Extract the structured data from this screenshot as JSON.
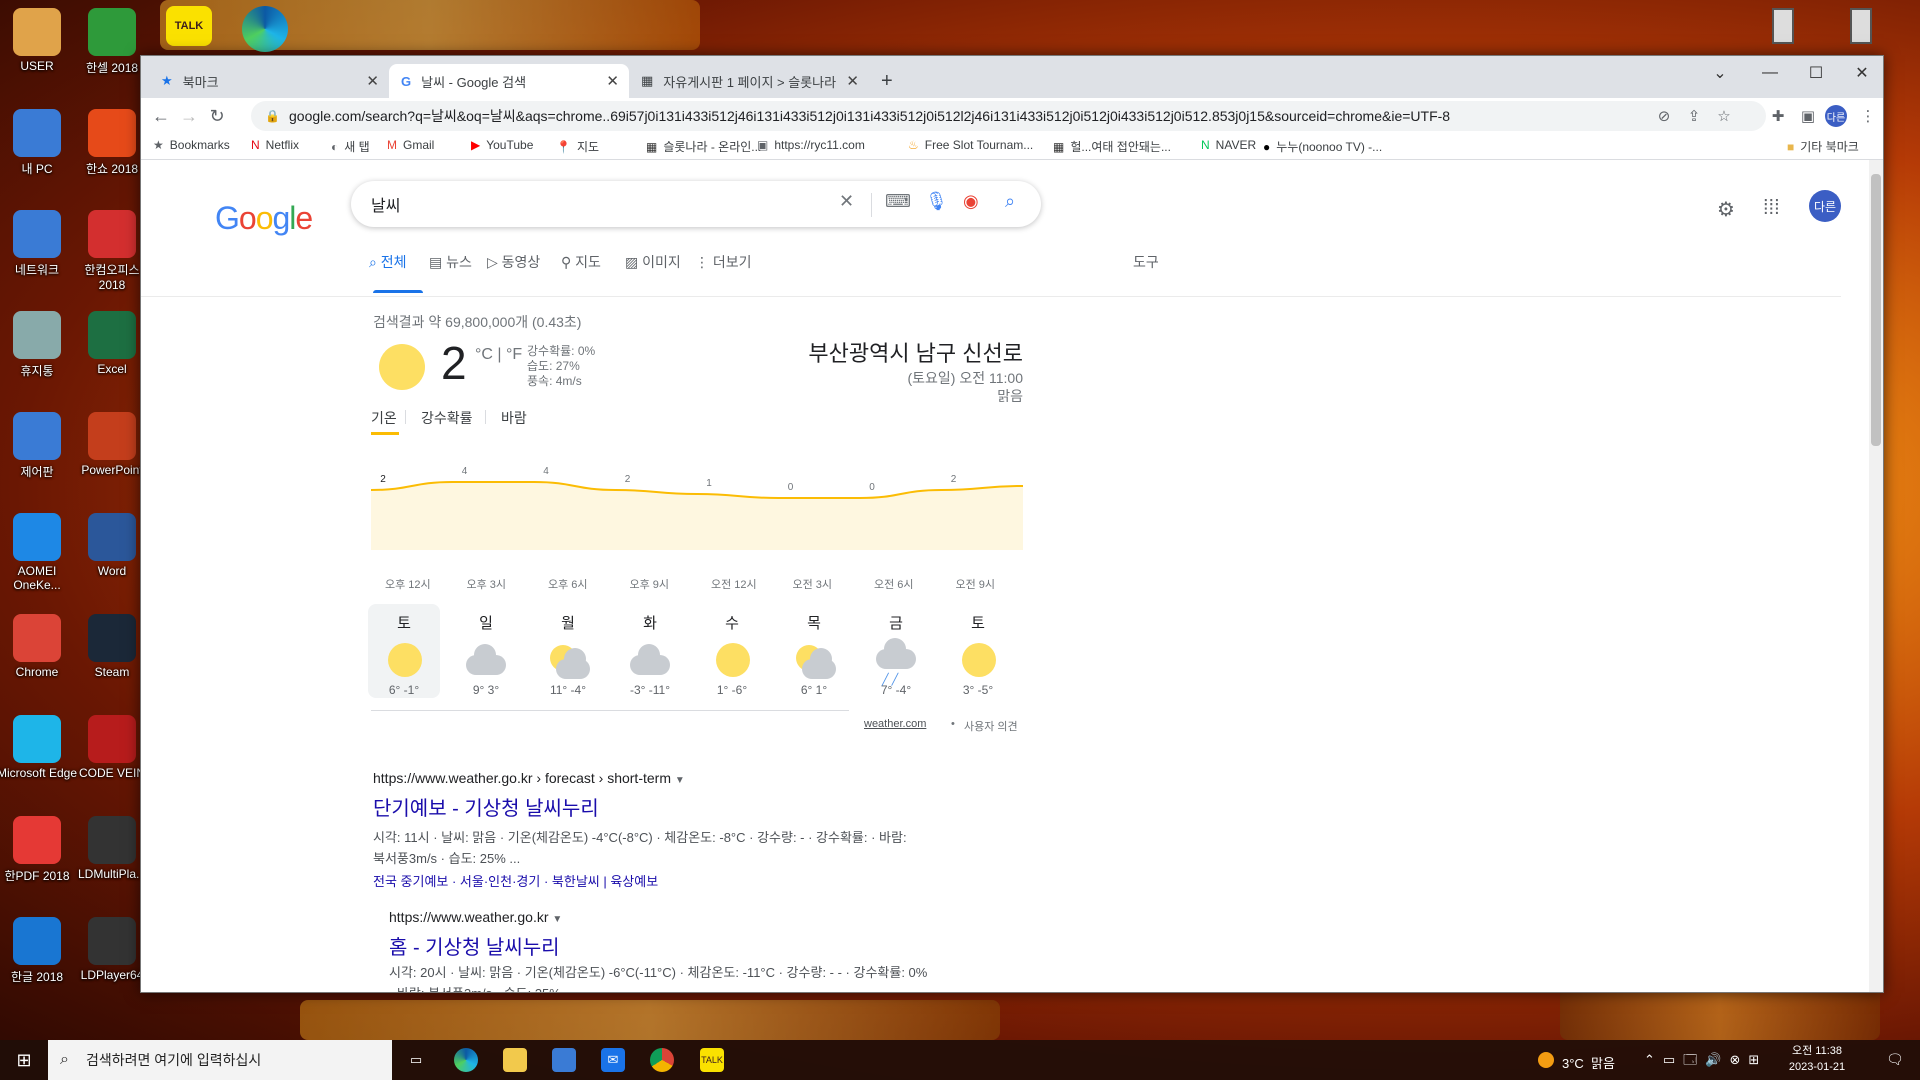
{
  "desktop": {
    "col1": [
      "USER",
      "내 PC",
      "네트워크",
      "휴지통",
      "제어판",
      "AOMEI OneKe...",
      "Chrome",
      "Microsoft Edge",
      "한PDF 2018",
      "한글 2018"
    ],
    "col2": [
      "한셀 2018",
      "한쇼 2018",
      "한컴오피스 2018",
      "Excel",
      "PowerPoint",
      "Word",
      "Steam",
      "CODE VEIN",
      "LDMultiPla...",
      "LDPlayer64"
    ],
    "topicons": [
      "TALK",
      ""
    ]
  },
  "browser": {
    "tabs": [
      {
        "label": "북마크",
        "icon": "star-icon"
      },
      {
        "label": "날씨 - Google 검색",
        "icon": "google-icon"
      },
      {
        "label": "자유게시판 1 페이지 > 슬롯나라",
        "icon": "film-icon"
      }
    ],
    "new_tab": "+",
    "url": "google.com/search?q=날씨&oq=날씨&aqs=chrome..69i57j0i131i433i512j46i131i433i512j0i131i433i512j0i512l2j46i131i433i512j0i512j0i433i512j0i512.853j0j15&sourceid=chrome&ie=UTF-8",
    "profile": "다른",
    "bookmarks": [
      "Bookmarks",
      "Netflix",
      "새 탭",
      "Gmail",
      "YouTube",
      "지도",
      "슬롯나라 - 온라인...",
      "https://ryc11.com",
      "Free Slot Tournam...",
      "헐...여태 접안돼는...",
      "NAVER",
      "누누(noonoo TV) -..."
    ],
    "other_bookmarks": "기타 북마크"
  },
  "google": {
    "logo": [
      "G",
      "o",
      "o",
      "g",
      "l",
      "e"
    ],
    "query": "날씨",
    "tabs": [
      "전체",
      "뉴스",
      "동영상",
      "지도",
      "이미지",
      "더보기"
    ],
    "tools": "도구",
    "result_stats": "검색결과 약 69,800,000개 (0.43초)",
    "avatar": "다른"
  },
  "weather": {
    "temp": "2",
    "units": "°C | °F",
    "precip": "강수확률: 0%",
    "humidity": "습도: 27%",
    "wind": "풍속: 4m/s",
    "location": "부산광역시 남구 신선로",
    "time": "(토요일) 오전 11:00",
    "condition": "맑음",
    "tabs": [
      "기온",
      "강수확률",
      "바람"
    ],
    "chart_points": [
      2,
      4,
      4,
      2,
      1,
      0,
      0,
      2,
      3
    ],
    "chart_labels": [
      "2",
      "4",
      "4",
      "2",
      "1",
      "0",
      "0",
      "2"
    ],
    "hours": [
      "오후 12시",
      "오후 3시",
      "오후 6시",
      "오후 9시",
      "오전 12시",
      "오전 3시",
      "오전 6시",
      "오전 9시"
    ],
    "days": [
      {
        "name": "토",
        "icon": "sunny",
        "temps": "6° -1°"
      },
      {
        "name": "일",
        "icon": "cloudy",
        "temps": "9° 3°"
      },
      {
        "name": "월",
        "icon": "partly-cloudy",
        "temps": "11° -4°"
      },
      {
        "name": "화",
        "icon": "cloudy",
        "temps": "-3° -11°"
      },
      {
        "name": "수",
        "icon": "sunny",
        "temps": "1° -6°"
      },
      {
        "name": "목",
        "icon": "partly-cloudy",
        "temps": "6° 1°"
      },
      {
        "name": "금",
        "icon": "rain",
        "temps": "7° -4°"
      },
      {
        "name": "토",
        "icon": "sunny",
        "temps": "3° -5°"
      }
    ],
    "source": "weather.com",
    "feedback": "사용자 의견"
  },
  "results": [
    {
      "url": "https://www.weather.go.kr › forecast › short-term",
      "title": "단기예보 - 기상청 날씨누리",
      "snippet1": "시각: 11시 · 날씨: 맑음 · 기온(체감온도) -4°C(-8°C) · 체감온도: -8°C · 강수량: - · 강수확률: · 바람:",
      "snippet2": "북서풍3m/s · 습도: 25% ...",
      "links": "전국 중기예보 · 서울·인천·경기 · 북한날씨 | 육상예보"
    },
    {
      "url": "https://www.weather.go.kr",
      "title": "홈 - 기상청 날씨누리",
      "snippet1": "시각: 20시 · 날씨: 맑음 · 기온(체감온도) -6°C(-11°C) · 체감온도: -11°C · 강수량: - - · 강수확률: 0%",
      "snippet2": "· 바람: 북서풍3m/s · 습도: 35% ..."
    }
  ],
  "taskbar": {
    "search_placeholder": "검색하려면 여기에 입력하십시",
    "weather": "3°C  맑음",
    "time": "오전 11:38",
    "date": "2023-01-21",
    "notif": "1"
  }
}
